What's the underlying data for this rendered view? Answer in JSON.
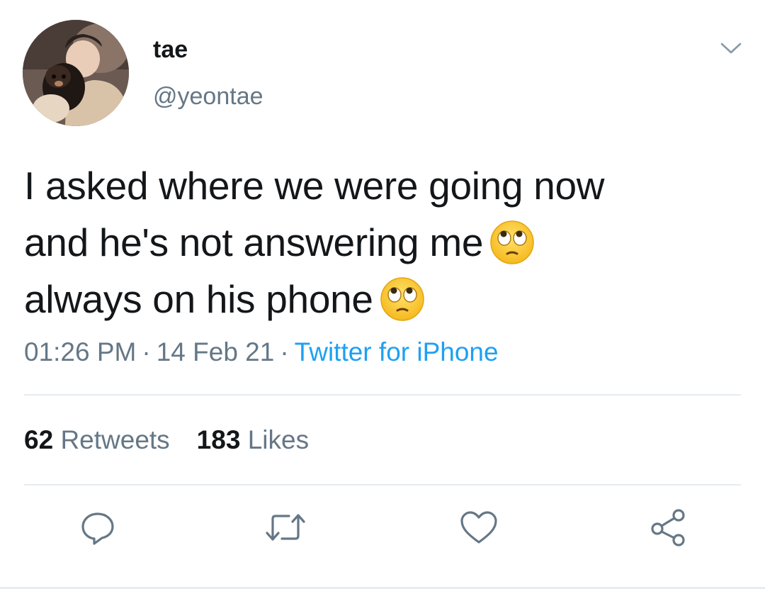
{
  "colors": {
    "text_primary": "#14171a",
    "text_secondary": "#657786",
    "link": "#1da1f2",
    "divider": "#e6ecf0"
  },
  "user": {
    "display_name": "tae",
    "handle": "@yeontae",
    "avatar_icon": "profile-photo"
  },
  "tweet": {
    "lines": [
      "I asked where we were going now",
      "and he's not answering me",
      "always on his phone"
    ],
    "emoji": "face-with-rolling-eyes",
    "time": "01:26 PM",
    "date": "14 Feb 21",
    "separator": "·",
    "source": "Twitter for iPhone"
  },
  "stats": {
    "retweets_count": "62",
    "retweets_label": "Retweets",
    "likes_count": "183",
    "likes_label": "Likes"
  },
  "actions": {
    "reply_icon": "reply-icon",
    "retweet_icon": "retweet-icon",
    "like_icon": "heart-icon",
    "share_icon": "share-icon",
    "menu_icon": "chevron-down-icon"
  }
}
